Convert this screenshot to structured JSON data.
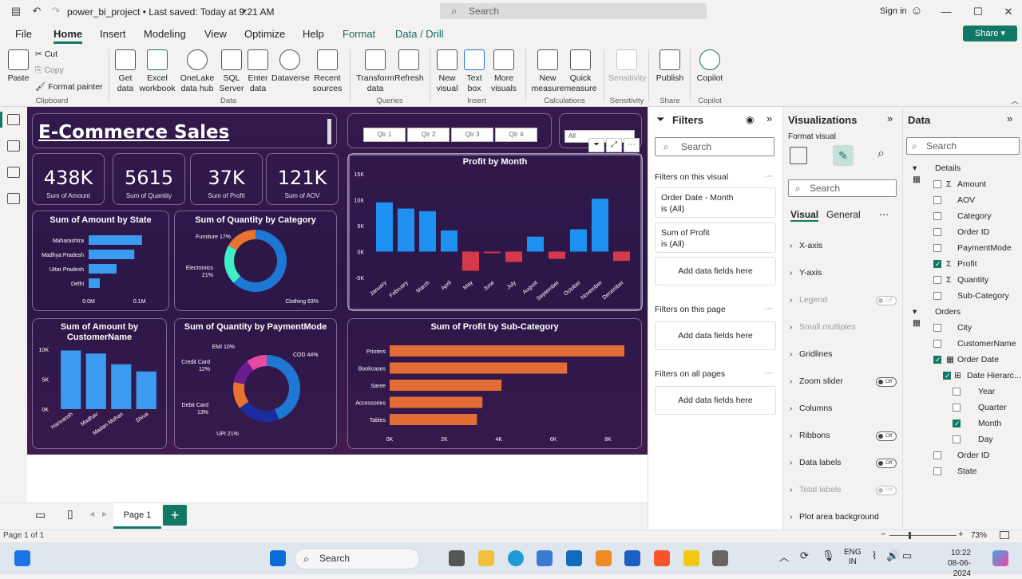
{
  "titlebar": {
    "doc_title": "power_bi_project • Last saved: Today at 9:21 AM",
    "search_placeholder": "Search",
    "signin": "Sign in"
  },
  "menu": {
    "items": [
      "File",
      "Home",
      "Insert",
      "Modeling",
      "View",
      "Optimize",
      "Help",
      "Format",
      "Data / Drill"
    ],
    "active": "Home",
    "share_label": "Share"
  },
  "ribbon": {
    "clipboard": {
      "paste": "Paste",
      "cut": "Cut",
      "copy": "Copy",
      "format_painter": "Format painter",
      "group": "Clipboard"
    },
    "data": {
      "get_data": "Get data",
      "excel": "Excel workbook",
      "onelake": "OneLake data hub",
      "sql": "SQL Server",
      "enter": "Enter data",
      "dataverse": "Dataverse",
      "recent": "Recent sources",
      "group": "Data"
    },
    "queries": {
      "transform": "Transform data",
      "refresh": "Refresh",
      "group": "Queries"
    },
    "insert": {
      "new_visual": "New visual",
      "text_box": "Text box",
      "more_visuals": "More visuals",
      "group": "Insert"
    },
    "calculations": {
      "new_measure": "New measure",
      "quick_measure": "Quick measure",
      "group": "Calculations"
    },
    "sensitivity": {
      "label": "Sensitivity",
      "group": "Sensitivity"
    },
    "share": {
      "publish": "Publish",
      "group": "Share"
    },
    "copilot": {
      "label": "Copilot",
      "group": "Copilot"
    }
  },
  "dashboard": {
    "title": "E-Commerce Sales",
    "quarters": [
      "Qtr 1",
      "Qtr 2",
      "Qtr 3",
      "Qtr 4"
    ],
    "slicer_all": "All",
    "kpis": [
      {
        "value": "438K",
        "label": "Sum of Amount"
      },
      {
        "value": "5615",
        "label": "Sum of Quantity"
      },
      {
        "value": "37K",
        "label": "Sum of Profit"
      },
      {
        "value": "121K",
        "label": "Sum of AOV"
      }
    ]
  },
  "chart_data": [
    {
      "type": "bar",
      "orientation": "horizontal",
      "title": "Sum of Amount by State",
      "categories": [
        "Maharashtra",
        "Madhya Pradesh",
        "Uttar Pradesh",
        "Delhi"
      ],
      "values": [
        0.105,
        0.09,
        0.055,
        0.022
      ],
      "x_tick_labels": [
        "0.0M",
        "0.1M"
      ],
      "xlim": [
        0,
        0.11
      ],
      "color": "#3a9bf0"
    },
    {
      "type": "pie",
      "donut": true,
      "title": "Sum of Quantity by Category",
      "categories": [
        "Clothing",
        "Electronics",
        "Furniture"
      ],
      "values": [
        63,
        21,
        17
      ],
      "labels": [
        "Clothing 63%",
        "Electronics 21%",
        "Furniture 17%"
      ],
      "colors": [
        "#1f77d4",
        "#3df0c8",
        "#e8732c"
      ]
    },
    {
      "type": "bar",
      "title": "Profit by Month",
      "categories": [
        "January",
        "February",
        "March",
        "April",
        "May",
        "June",
        "July",
        "August",
        "September",
        "October",
        "November",
        "December"
      ],
      "values": [
        9500,
        8300,
        7800,
        4100,
        -3700,
        -300,
        -2000,
        2900,
        -1400,
        4300,
        10200,
        -1800
      ],
      "y_ticks": [
        "15K",
        "10K",
        "5K",
        "0K",
        "-5K"
      ],
      "ylim": [
        -5000,
        15000
      ],
      "colors": {
        "positive": "#1e90f0",
        "negative": "#d63a4a"
      }
    },
    {
      "type": "bar",
      "title": "Sum of Amount by CustomerName",
      "categories": [
        "Harivansh",
        "Madhav",
        "Madan Mohan",
        "Shiva"
      ],
      "values": [
        9800,
        9300,
        7500,
        6300
      ],
      "y_ticks": [
        "10K",
        "5K",
        "0K"
      ],
      "ylim": [
        0,
        10000
      ],
      "color": "#3a9bf0"
    },
    {
      "type": "pie",
      "donut": true,
      "title": "Sum of Quantity by PaymentMode",
      "categories": [
        "COD",
        "UPI",
        "Debit Card",
        "Credit Card",
        "EMI"
      ],
      "values": [
        44,
        21,
        13,
        12,
        10
      ],
      "labels": [
        "COD 44%",
        "UPI 21%",
        "Debit Card 13%",
        "Credit Card 12%",
        "EMI 10%"
      ],
      "colors": [
        "#1f77d4",
        "#1a2d9e",
        "#e8732c",
        "#6b1d8f",
        "#e84a9e"
      ]
    },
    {
      "type": "bar",
      "orientation": "horizontal",
      "title": "Sum of Profit by Sub-Category",
      "categories": [
        "Printers",
        "Bookcases",
        "Saree",
        "Accessories",
        "Tables"
      ],
      "values": [
        8600,
        6500,
        4100,
        3400,
        3200
      ],
      "x_ticks": [
        "0K",
        "2K",
        "4K",
        "6K",
        "8K"
      ],
      "xlim": [
        0,
        8600
      ],
      "color": "#e36b35"
    }
  ],
  "filters": {
    "title": "Filters",
    "search": "Search",
    "on_visual_label": "Filters on this visual",
    "visual_filters": [
      {
        "field": "Order Date - Month",
        "state": "is (All)"
      },
      {
        "field": "Sum of Profit",
        "state": "is (All)"
      }
    ],
    "add_fields": "Add data fields here",
    "on_page_label": "Filters on this page",
    "all_pages_label": "Filters on all pages"
  },
  "visualizations": {
    "title": "Visualizations",
    "format_label": "Format visual",
    "search": "Search",
    "tabs": [
      "Visual",
      "General"
    ],
    "sections": [
      {
        "label": "X-axis",
        "toggle": null,
        "enabled": true
      },
      {
        "label": "Y-axis",
        "toggle": null,
        "enabled": true
      },
      {
        "label": "Legend",
        "toggle": "Off",
        "enabled": false
      },
      {
        "label": "Small multiples",
        "toggle": null,
        "enabled": false
      },
      {
        "label": "Gridlines",
        "toggle": null,
        "enabled": true
      },
      {
        "label": "Zoom slider",
        "toggle": "Off",
        "enabled": true
      },
      {
        "label": "Columns",
        "toggle": null,
        "enabled": true
      },
      {
        "label": "Ribbons",
        "toggle": "Off",
        "enabled": true
      },
      {
        "label": "Data labels",
        "toggle": "Off",
        "enabled": true
      },
      {
        "label": "Total labels",
        "toggle": "Off",
        "enabled": false
      },
      {
        "label": "Plot area background",
        "toggle": null,
        "enabled": true
      }
    ]
  },
  "data_pane": {
    "title": "Data",
    "search": "Search",
    "tables": [
      {
        "name": "Details",
        "fields": [
          {
            "name": "Amount",
            "sigma": true,
            "checked": false
          },
          {
            "name": "AOV",
            "sigma": false,
            "checked": false
          },
          {
            "name": "Category",
            "sigma": false,
            "checked": false
          },
          {
            "name": "Order ID",
            "sigma": false,
            "checked": false
          },
          {
            "name": "PaymentMode",
            "sigma": false,
            "checked": false
          },
          {
            "name": "Profit",
            "sigma": true,
            "checked": true
          },
          {
            "name": "Quantity",
            "sigma": true,
            "checked": false
          },
          {
            "name": "Sub-Category",
            "sigma": false,
            "checked": false
          }
        ]
      },
      {
        "name": "Orders",
        "fields": [
          {
            "name": "City",
            "checked": false
          },
          {
            "name": "CustomerName",
            "checked": false
          },
          {
            "name": "Order Date",
            "checked": true
          },
          {
            "name": "Date Hierarc...",
            "checked": true
          },
          {
            "name": "Year",
            "checked": false
          },
          {
            "name": "Quarter",
            "checked": false
          },
          {
            "name": "Month",
            "checked": true
          },
          {
            "name": "Day",
            "checked": false
          },
          {
            "name": "Order ID",
            "checked": false
          },
          {
            "name": "State",
            "checked": false
          }
        ]
      }
    ]
  },
  "pages": {
    "current": "Page 1",
    "status": "Page 1 of 1",
    "zoom": "73%"
  },
  "taskbar": {
    "search": "Search",
    "lang": "ENG",
    "region": "IN",
    "time": "10:22",
    "date": "08-06-2024"
  }
}
